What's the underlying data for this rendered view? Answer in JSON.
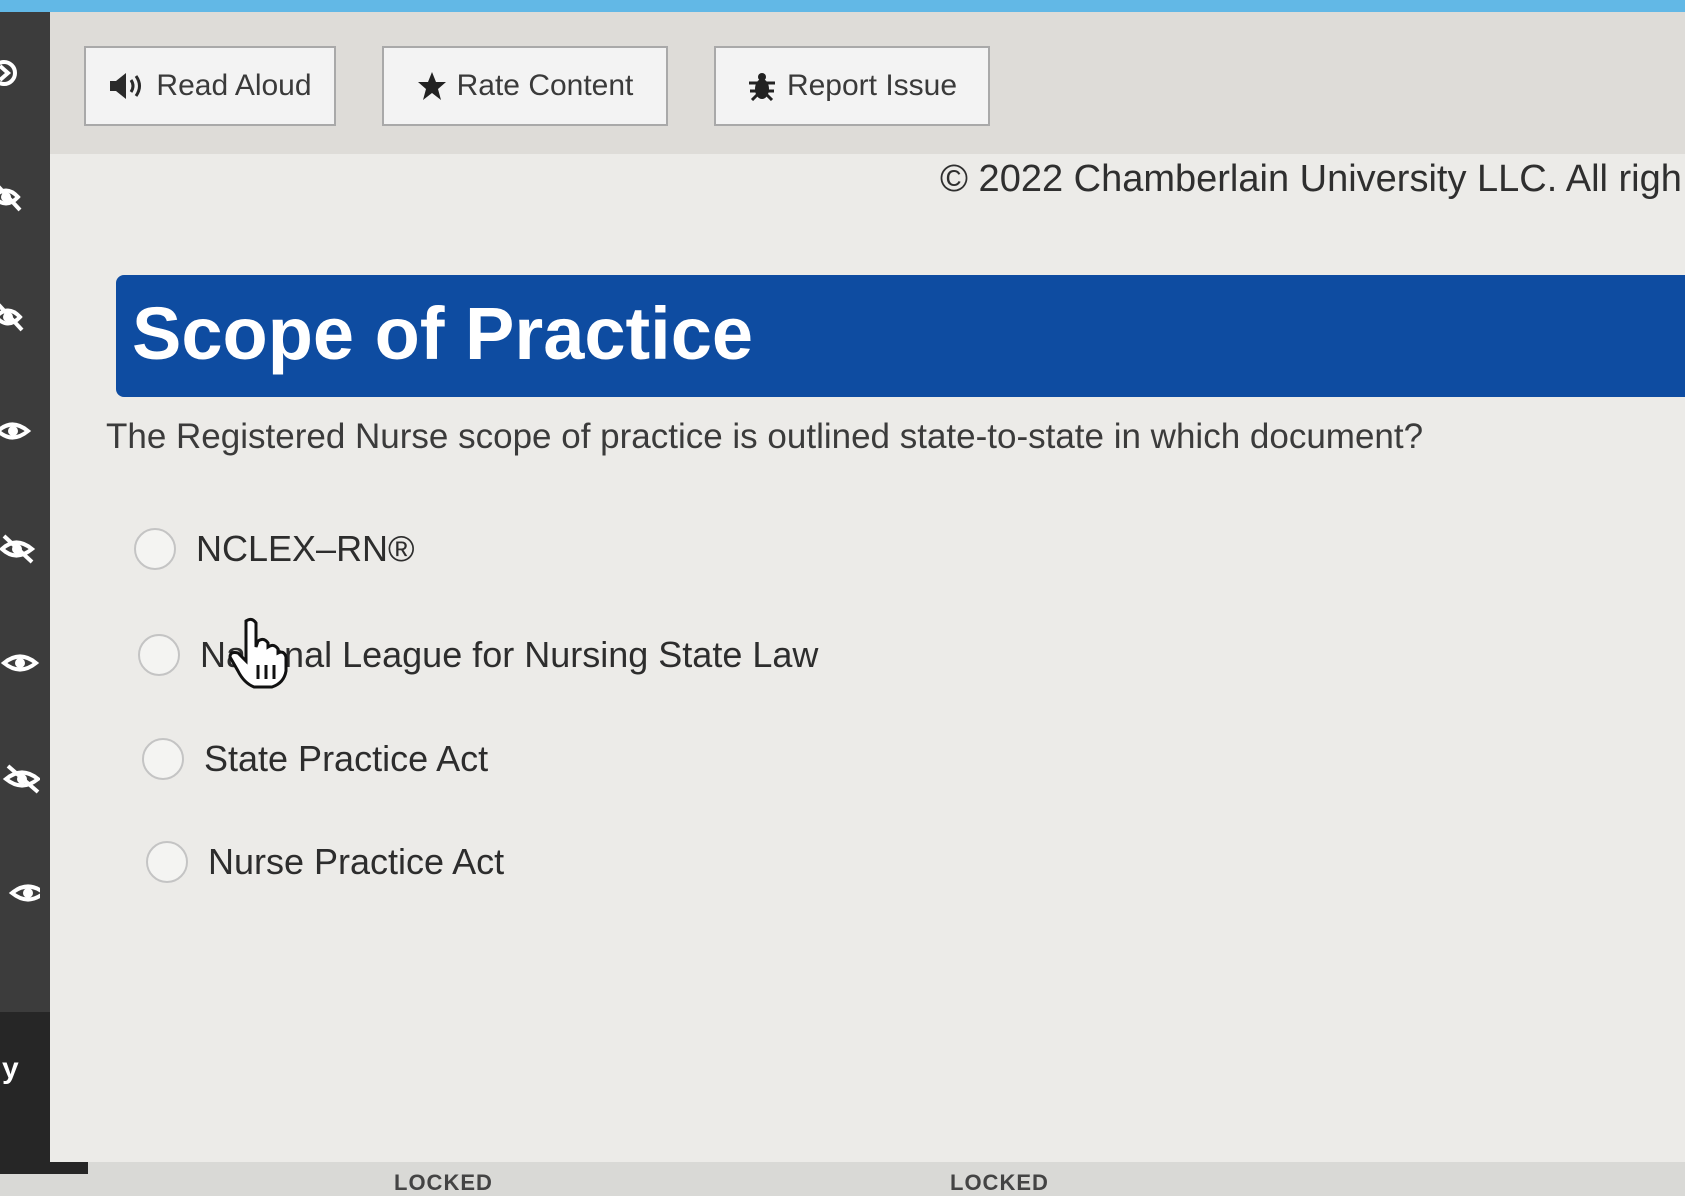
{
  "toolbar": {
    "read_aloud": "Read Aloud",
    "rate_content": "Rate Content",
    "report_issue": "Report Issue"
  },
  "copyright": "© 2022 Chamberlain University LLC. All righ",
  "banner": {
    "title": "Scope of Practice"
  },
  "question": "The Registered Nurse scope of practice is outlined state-to-state in which document?",
  "options": [
    {
      "label": "NCLEX–RN®"
    },
    {
      "label": "National League for Nursing State Law"
    },
    {
      "label": "State Practice Act"
    },
    {
      "label": "Nurse Practice Act"
    }
  ],
  "sidebar": {
    "icons": [
      "chevron-right-icon",
      "eye-slash-icon",
      "eye-slash-icon",
      "eye-icon",
      "eye-slash-icon",
      "eye-icon",
      "eye-slash-icon",
      "eye-icon"
    ],
    "partial_label": "y"
  },
  "bottom": {
    "tab1": "LOCKED",
    "tab2": "LOCKED"
  },
  "colors": {
    "banner": "#0e4ca1",
    "sidebar": "#3c3c3c",
    "top_strip": "#62b8e6"
  }
}
